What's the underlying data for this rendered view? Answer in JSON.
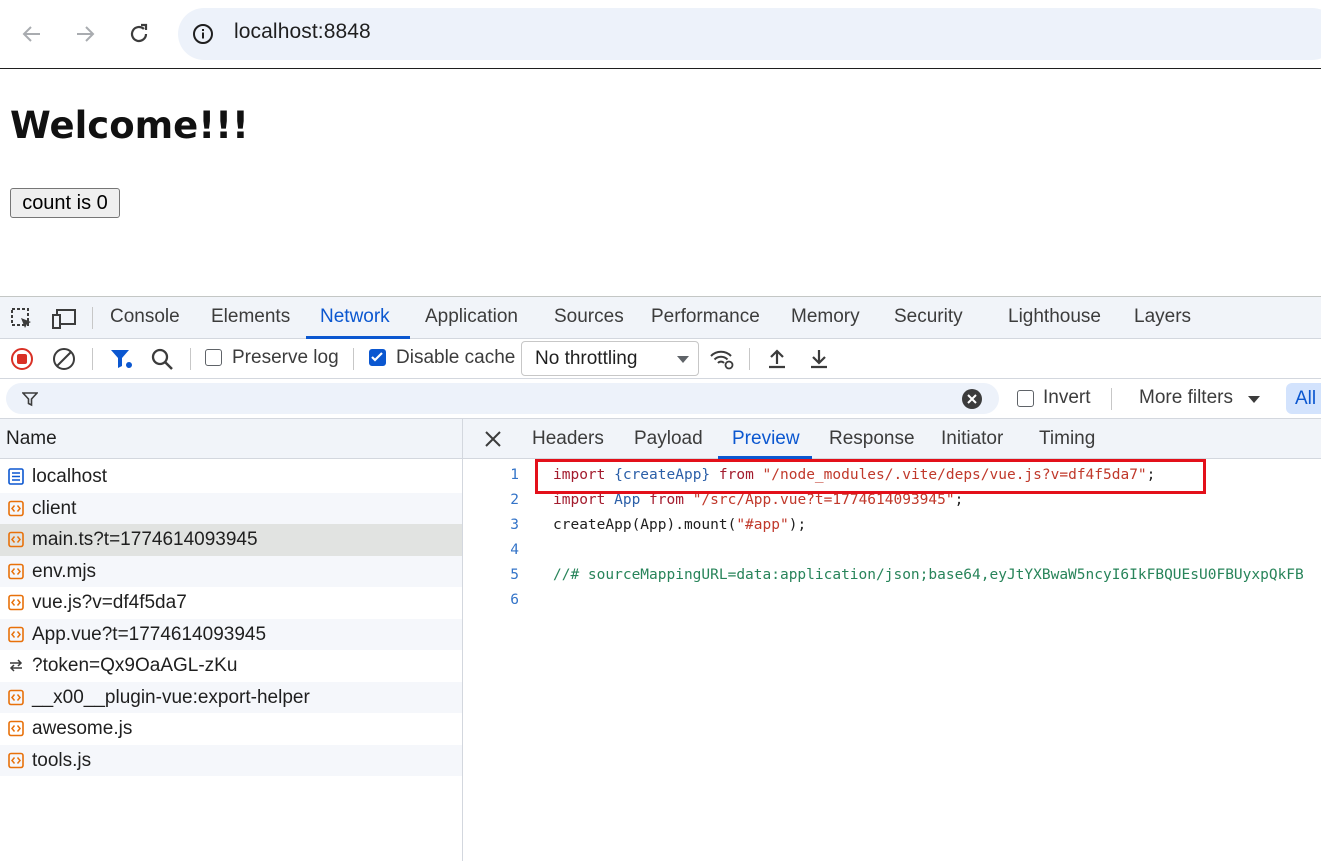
{
  "browser": {
    "url": "localhost:8848"
  },
  "page": {
    "heading": "Welcome!!!",
    "count_button": "count is 0"
  },
  "devtools": {
    "tabs": [
      {
        "label": "Console"
      },
      {
        "label": "Elements"
      },
      {
        "label": "Network",
        "active": true
      },
      {
        "label": "Application"
      },
      {
        "label": "Sources"
      },
      {
        "label": "Performance"
      },
      {
        "label": "Memory"
      },
      {
        "label": "Security"
      },
      {
        "label": "Lighthouse"
      },
      {
        "label": "Layers"
      }
    ],
    "toolbar": {
      "preserve_log": "Preserve log",
      "preserve_log_checked": false,
      "disable_cache": "Disable cache",
      "disable_cache_checked": true,
      "throttling": "No throttling"
    },
    "filter": {
      "invert": "Invert",
      "invert_checked": false,
      "more_filters": "More filters",
      "all": "All"
    },
    "requests": {
      "header": "Name",
      "items": [
        {
          "name": "localhost",
          "type": "document"
        },
        {
          "name": "client",
          "type": "script"
        },
        {
          "name": "main.ts?t=1774614093945",
          "type": "script",
          "selected": true
        },
        {
          "name": "env.mjs",
          "type": "script"
        },
        {
          "name": "vue.js?v=df4f5da7",
          "type": "script"
        },
        {
          "name": "App.vue?t=1774614093945",
          "type": "script"
        },
        {
          "name": "?token=Qx9OaAGL-zKu",
          "type": "websocket"
        },
        {
          "name": "__x00__plugin-vue:export-helper",
          "type": "script"
        },
        {
          "name": "awesome.js",
          "type": "script"
        },
        {
          "name": "tools.js",
          "type": "script"
        }
      ]
    },
    "detail": {
      "tabs": [
        {
          "label": "Headers"
        },
        {
          "label": "Payload"
        },
        {
          "label": "Preview",
          "active": true
        },
        {
          "label": "Response"
        },
        {
          "label": "Initiator"
        },
        {
          "label": "Timing"
        }
      ],
      "code": {
        "line_numbers": [
          "1",
          "2",
          "3",
          "4",
          "5",
          "6"
        ],
        "line1": {
          "kw1": "import",
          "brace": " {createApp} ",
          "kw2": "from",
          "str": " \"/node_modules/.vite/deps/vue.js?v=df4f5da7\"",
          "end": ";"
        },
        "line2": {
          "kw1": "import",
          "var": " App ",
          "kw2": "from",
          "str": " \"/src/App.vue?t=1774614093945\"",
          "end": ";"
        },
        "line3": {
          "pre": "createApp(App).mount(",
          "str": "\"#app\"",
          "end": ");"
        },
        "line5": "//# sourceMappingURL=data:application/json;base64,eyJtYXBwaW5ncyI6IkFBQUEsU0FBUyxpQkFB"
      }
    }
  }
}
